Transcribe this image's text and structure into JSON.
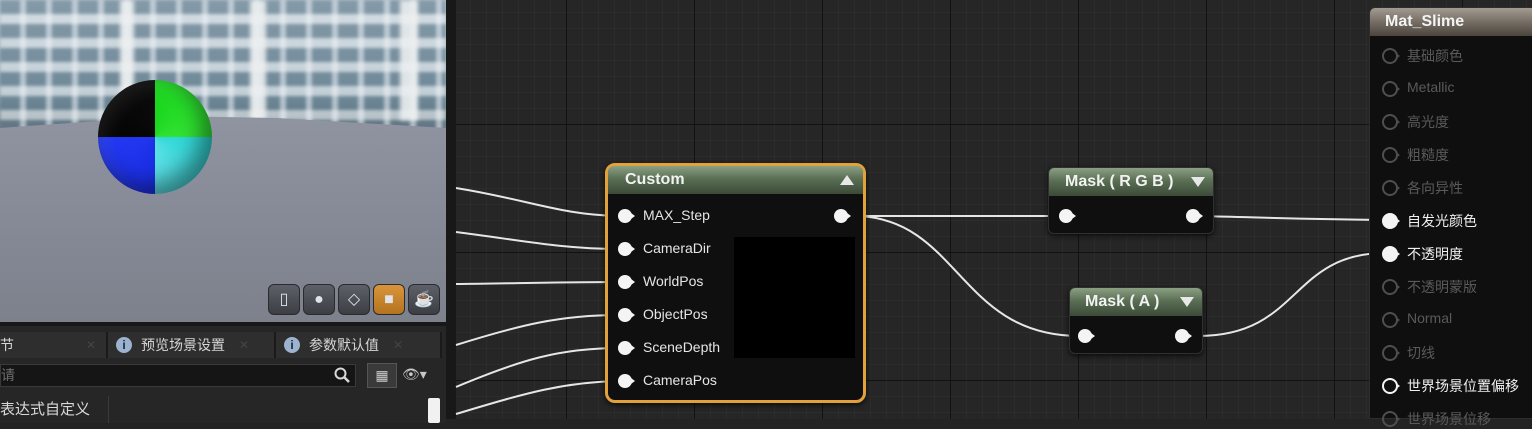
{
  "viewport": {
    "toolbar_icons": [
      "cylinder-icon",
      "sphere-icon",
      "plane-icon",
      "cube-icon",
      "teapot-icon"
    ]
  },
  "panel": {
    "tabs": [
      {
        "label": "节",
        "icon": ""
      },
      {
        "label": "预览场景设置",
        "icon": "info-icon"
      },
      {
        "label": "参数默认值",
        "icon": "info-icon"
      }
    ],
    "search_placeholder": "请",
    "detail_label": "表达式自定义"
  },
  "nodes": {
    "custom": {
      "title": "Custom",
      "inputs": [
        "MAX_Step",
        "CameraDir",
        "WorldPos",
        "ObjectPos",
        "SceneDepth",
        "CameraPos"
      ]
    },
    "mask_rgb": {
      "title": "Mask ( R G B )"
    },
    "mask_a": {
      "title": "Mask ( A )"
    }
  },
  "material": {
    "title": "Mat_Slime",
    "pins": [
      {
        "label": "基础颜色",
        "active": false
      },
      {
        "label": "Metallic",
        "active": false
      },
      {
        "label": "高光度",
        "active": false
      },
      {
        "label": "粗糙度",
        "active": false
      },
      {
        "label": "各向异性",
        "active": false
      },
      {
        "label": "自发光颜色",
        "active": true
      },
      {
        "label": "不透明度",
        "active": true
      },
      {
        "label": "不透明蒙版",
        "active": false
      },
      {
        "label": "Normal",
        "active": false
      },
      {
        "label": "切线",
        "active": false
      },
      {
        "label": "世界场景位置偏移",
        "active": true
      },
      {
        "label": "世界场景位移",
        "active": false
      }
    ]
  },
  "colors": {
    "custom_border": "#e3a13a",
    "graph_bg": "#262626",
    "node_header_green": "#5a6f54",
    "material_header": "#7a7268"
  }
}
